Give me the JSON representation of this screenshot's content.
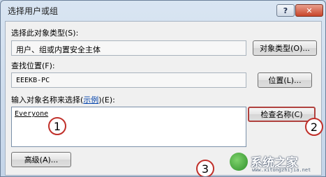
{
  "window": {
    "title": "选择用户或组",
    "help_label": "?",
    "close_label": "✕"
  },
  "object_type": {
    "label": "选择此对象类型(S):",
    "value": "用户、组或内置安全主体",
    "button": "对象类型(O)..."
  },
  "location": {
    "label": "查找位置(F):",
    "value": "EEEKB-PC",
    "button": "位置(L)..."
  },
  "names": {
    "label_prefix": "输入对象名称来选择(",
    "label_link": "示例",
    "label_suffix": ")(E):",
    "value": "Everyone",
    "check_button": "检查名称(C)"
  },
  "advanced_button": "高级(A)...",
  "callouts": [
    "1",
    "2",
    "3"
  ],
  "watermark": {
    "brand": "系统之家",
    "site": "www.xitongzhijia.net"
  }
}
